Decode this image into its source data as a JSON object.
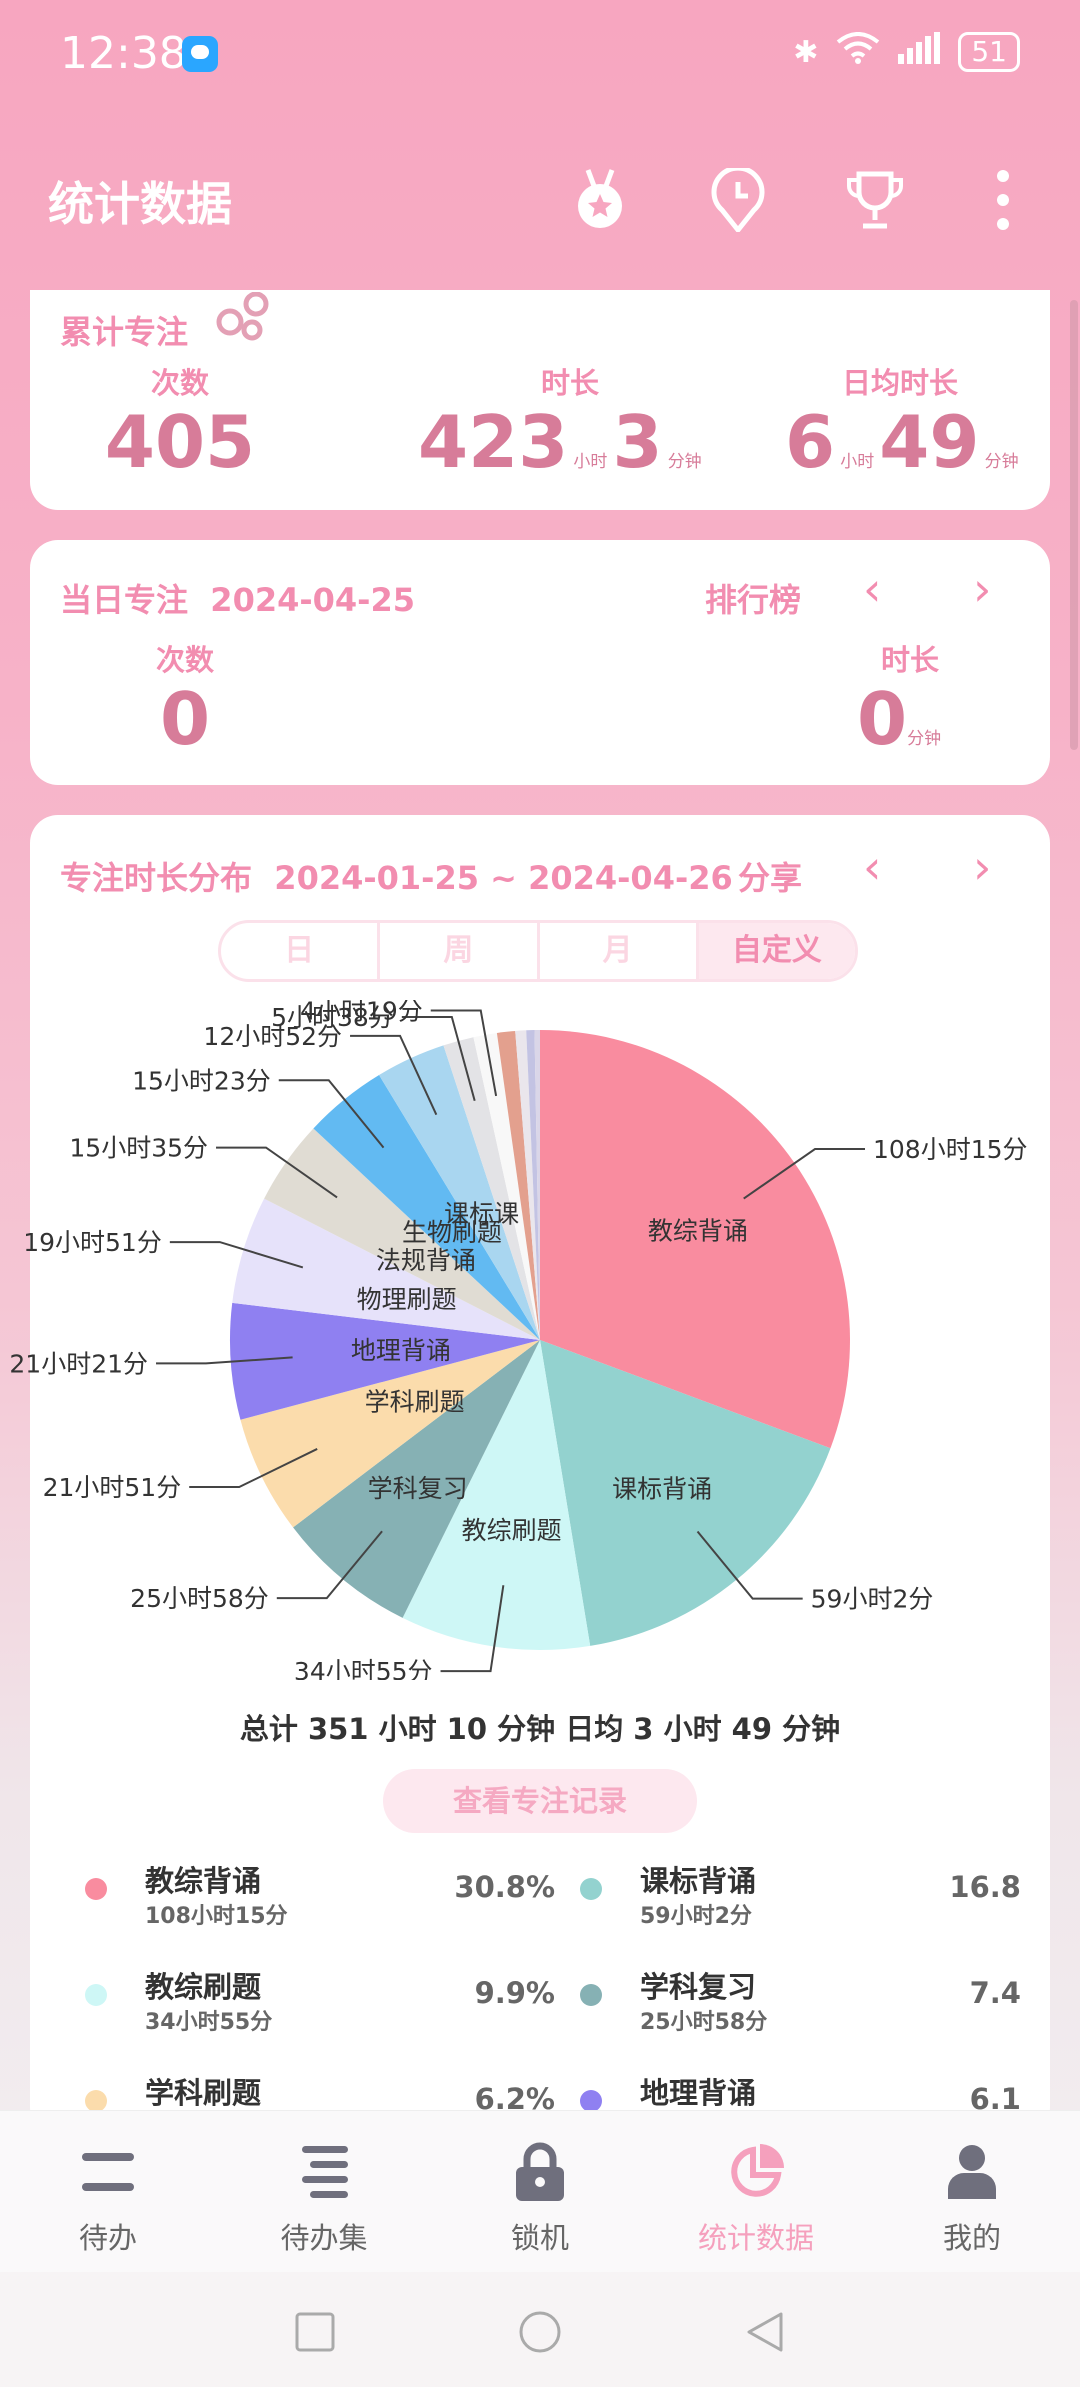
{
  "status": {
    "time": "12:38",
    "battery": "51"
  },
  "app_bar": {
    "title": "统计数据"
  },
  "cumulative": {
    "title": "累计专注",
    "count_label": "次数",
    "count": "405",
    "duration_label": "时长",
    "hours": "423",
    "hour_unit": "小时",
    "minutes": "3",
    "minute_unit": "分钟",
    "daily_label": "日均时长",
    "daily_hours": "6",
    "daily_minutes": "49"
  },
  "today": {
    "title": "当日专注",
    "date": "2024-04-25",
    "ranking": "排行榜",
    "count_label": "次数",
    "count": "0",
    "duration_label": "时长",
    "duration": "0",
    "minute_unit": "分钟"
  },
  "distribution": {
    "title": "专注时长分布",
    "range": "2024-01-25 ~ 2024-04-26",
    "share": "分享",
    "tabs": [
      "日",
      "周",
      "月",
      "自定义"
    ],
    "selected_tab": "自定义",
    "summary": "总计 351 小时 10 分钟 日均 3 小时 49 分钟",
    "record_button": "查看专注记录"
  },
  "chart_data": {
    "type": "pie",
    "unit": "minutes",
    "slices": [
      {
        "name": "教综背诵",
        "label": "108小时15分",
        "value": 6495,
        "percent": "30.8%",
        "color": "#f98c9f"
      },
      {
        "name": "课标背诵",
        "label": "59小时2分",
        "value": 3542,
        "percent": "16.8%",
        "color": "#93d2cf"
      },
      {
        "name": "教综刷题",
        "label": "34小时55分",
        "value": 2095,
        "percent": "9.9%",
        "color": "#cef7f6"
      },
      {
        "name": "学科复习",
        "label": "25小时58分",
        "value": 1558,
        "percent": "7.4%",
        "color": "#86b1b4"
      },
      {
        "name": "学科刷题",
        "label": "21小时51分",
        "value": 1311,
        "percent": "6.2%",
        "color": "#fbdcac"
      },
      {
        "name": "地理背诵",
        "label": "21小时21分",
        "value": 1281,
        "percent": "6.1%",
        "color": "#8f80f1"
      },
      {
        "name": "物理刷题",
        "label": "19小时51分",
        "value": 1191,
        "color": "#e6e2fa"
      },
      {
        "name": "法规背诵",
        "label": "15小时35分",
        "value": 935,
        "color": "#e0dcd3"
      },
      {
        "name": "生物刷题",
        "label": "15小时23分",
        "value": 923,
        "color": "#62baf2"
      },
      {
        "name": "课标课",
        "label": "12小时52分",
        "value": 772,
        "color": "#a9d6f0"
      },
      {
        "name": "",
        "label": "5小时38分",
        "value": 338,
        "color": "#e3e3e6"
      },
      {
        "name": "",
        "label": "4小时19分",
        "value": 259,
        "color": "#f8f8f8"
      },
      {
        "name": "",
        "label": "",
        "value": 200,
        "color": "#e3a08e"
      },
      {
        "name": "",
        "label": "",
        "value": 120,
        "color": "#eae6ec"
      },
      {
        "name": "",
        "label": "",
        "value": 90,
        "color": "#c3c3e3"
      },
      {
        "name": "",
        "label": "",
        "value": 60,
        "color": "#dad6e8"
      }
    ]
  },
  "legend": [
    {
      "name": "教综背诵",
      "time": "108小时15分",
      "percent": "30.8%",
      "color": "#f98c9f"
    },
    {
      "name": "课标背诵",
      "time": "59小时2分",
      "percent": "16.8%",
      "color": "#93d2cf"
    },
    {
      "name": "教综刷题",
      "time": "34小时55分",
      "percent": "9.9%",
      "color": "#cef7f6"
    },
    {
      "name": "学科复习",
      "time": "25小时58分",
      "percent": "7.4%",
      "color": "#86b1b4"
    },
    {
      "name": "学科刷题",
      "time": "",
      "percent": "6.2%",
      "color": "#fbdcac"
    },
    {
      "name": "地理背诵",
      "time": "",
      "percent": "6.1%",
      "color": "#8f80f1"
    }
  ],
  "nav": [
    {
      "label": "待办",
      "icon": "todo-icon"
    },
    {
      "label": "待办集",
      "icon": "todo-set-icon"
    },
    {
      "label": "锁机",
      "icon": "lock-icon"
    },
    {
      "label": "统计数据",
      "icon": "stats-pie-icon",
      "active": true
    },
    {
      "label": "我的",
      "icon": "profile-icon"
    }
  ],
  "colors": {
    "accent": "#f28db0",
    "active_nav": "#f5a0bd"
  }
}
